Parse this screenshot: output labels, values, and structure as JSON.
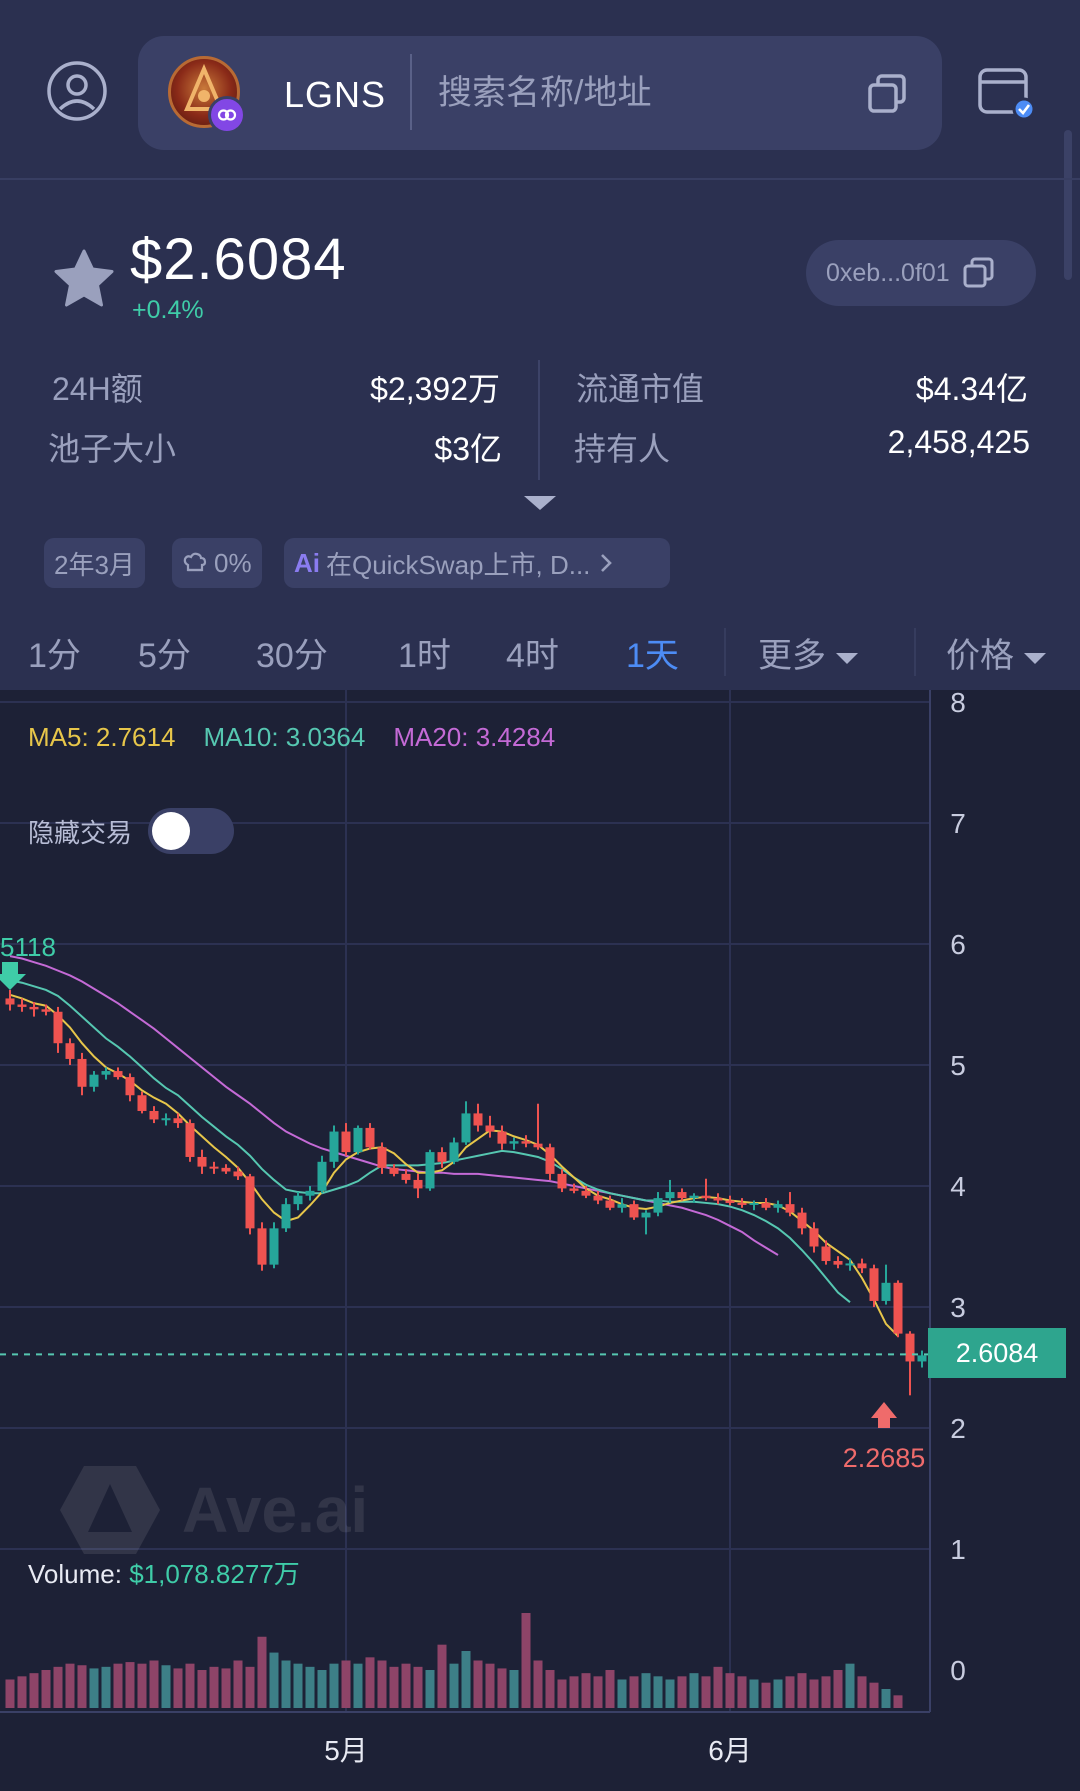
{
  "header": {
    "token_symbol": "LGNS",
    "search_placeholder": "搜索名称/地址"
  },
  "price_panel": {
    "price": "$2.6084",
    "change": "+0.4%",
    "address": "0xeb...0f01"
  },
  "stats": {
    "volume_24h_label": "24H额",
    "volume_24h_value": "$2,392万",
    "market_cap_label": "流通市值",
    "market_cap_value": "$4.34亿",
    "pool_size_label": "池子大小",
    "pool_size_value": "$3亿",
    "holders_label": "持有人",
    "holders_value": "2,458,425"
  },
  "tags": {
    "age": "2年3月",
    "tax": "0%",
    "ai_label": "Ai",
    "ai_summary": "在QuickSwap上市, D..."
  },
  "tabs": [
    {
      "label": "1分",
      "active": false
    },
    {
      "label": "5分",
      "active": false
    },
    {
      "label": "30分",
      "active": false
    },
    {
      "label": "1时",
      "active": false
    },
    {
      "label": "4时",
      "active": false
    },
    {
      "label": "1天",
      "active": true
    }
  ],
  "tab_more": "更多",
  "tab_price": "价格",
  "indicators": {
    "ma5": "MA5: 2.7614",
    "ma10": "MA10: 3.0364",
    "ma20": "MA20: 3.4284",
    "ma5_color": "#e7c64a",
    "ma10_color": "#56c7b1",
    "ma20_color": "#c46ad6"
  },
  "hide_trades_label": "隐藏交易",
  "hide_trades_on": false,
  "volume": {
    "label": "Volume:",
    "value": "$1,078.8277万"
  },
  "watermark": "Ave.ai",
  "colors": {
    "up": "#26a69a",
    "down": "#ef5350",
    "accent": "#4d8cf5",
    "positive": "#3fcca8"
  },
  "chart_data": {
    "type": "candlestick",
    "interval": "1天",
    "y_axis_ticks": [
      0,
      1,
      2,
      3,
      4,
      5,
      6,
      7,
      8
    ],
    "x_axis_ticks": [
      "5月",
      "6月"
    ],
    "x_tick_index": {
      "5月": 28,
      "6月": 60
    },
    "ylim": [
      0,
      8
    ],
    "current_price": 2.6084,
    "current_price_label": "2.6084",
    "marked_high": 5.5118,
    "marked_high_label": "5118",
    "marked_high_index": 0,
    "marked_low": 2.2685,
    "marked_low_label": "2.2685",
    "marked_low_index": 71,
    "candles": [
      {
        "o": 5.55,
        "h": 5.62,
        "l": 5.45,
        "c": 5.5
      },
      {
        "o": 5.5,
        "h": 5.55,
        "l": 5.44,
        "c": 5.48
      },
      {
        "o": 5.48,
        "h": 5.52,
        "l": 5.4,
        "c": 5.46
      },
      {
        "o": 5.46,
        "h": 5.5,
        "l": 5.41,
        "c": 5.44
      },
      {
        "o": 5.44,
        "h": 5.48,
        "l": 5.1,
        "c": 5.18
      },
      {
        "o": 5.18,
        "h": 5.22,
        "l": 5.0,
        "c": 5.05
      },
      {
        "o": 5.05,
        "h": 5.1,
        "l": 4.75,
        "c": 4.82
      },
      {
        "o": 4.82,
        "h": 4.95,
        "l": 4.78,
        "c": 4.92
      },
      {
        "o": 4.92,
        "h": 4.98,
        "l": 4.88,
        "c": 4.95
      },
      {
        "o": 4.95,
        "h": 4.98,
        "l": 4.88,
        "c": 4.9
      },
      {
        "o": 4.9,
        "h": 4.93,
        "l": 4.7,
        "c": 4.75
      },
      {
        "o": 4.75,
        "h": 4.78,
        "l": 4.6,
        "c": 4.62
      },
      {
        "o": 4.62,
        "h": 4.66,
        "l": 4.52,
        "c": 4.55
      },
      {
        "o": 4.55,
        "h": 4.6,
        "l": 4.5,
        "c": 4.56
      },
      {
        "o": 4.56,
        "h": 4.6,
        "l": 4.48,
        "c": 4.52
      },
      {
        "o": 4.52,
        "h": 4.55,
        "l": 4.2,
        "c": 4.24
      },
      {
        "o": 4.24,
        "h": 4.3,
        "l": 4.1,
        "c": 4.16
      },
      {
        "o": 4.16,
        "h": 4.2,
        "l": 4.1,
        "c": 4.15
      },
      {
        "o": 4.15,
        "h": 4.18,
        "l": 4.1,
        "c": 4.12
      },
      {
        "o": 4.12,
        "h": 4.16,
        "l": 4.05,
        "c": 4.08
      },
      {
        "o": 4.08,
        "h": 4.1,
        "l": 3.6,
        "c": 3.65
      },
      {
        "o": 3.65,
        "h": 3.7,
        "l": 3.3,
        "c": 3.35
      },
      {
        "o": 3.35,
        "h": 3.7,
        "l": 3.32,
        "c": 3.65
      },
      {
        "o": 3.65,
        "h": 3.9,
        "l": 3.62,
        "c": 3.85
      },
      {
        "o": 3.85,
        "h": 3.95,
        "l": 3.8,
        "c": 3.92
      },
      {
        "o": 3.92,
        "h": 4.0,
        "l": 3.88,
        "c": 3.96
      },
      {
        "o": 3.96,
        "h": 4.25,
        "l": 3.94,
        "c": 4.2
      },
      {
        "o": 4.2,
        "h": 4.5,
        "l": 4.15,
        "c": 4.45
      },
      {
        "o": 4.45,
        "h": 4.52,
        "l": 4.25,
        "c": 4.28
      },
      {
        "o": 4.28,
        "h": 4.5,
        "l": 4.26,
        "c": 4.48
      },
      {
        "o": 4.48,
        "h": 4.52,
        "l": 4.3,
        "c": 4.32
      },
      {
        "o": 4.32,
        "h": 4.36,
        "l": 4.1,
        "c": 4.15
      },
      {
        "o": 4.15,
        "h": 4.18,
        "l": 4.08,
        "c": 4.1
      },
      {
        "o": 4.1,
        "h": 4.14,
        "l": 4.02,
        "c": 4.05
      },
      {
        "o": 4.05,
        "h": 4.1,
        "l": 3.9,
        "c": 3.98
      },
      {
        "o": 3.98,
        "h": 4.3,
        "l": 3.96,
        "c": 4.28
      },
      {
        "o": 4.28,
        "h": 4.32,
        "l": 4.15,
        "c": 4.2
      },
      {
        "o": 4.2,
        "h": 4.4,
        "l": 4.18,
        "c": 4.36
      },
      {
        "o": 4.36,
        "h": 4.7,
        "l": 4.34,
        "c": 4.6
      },
      {
        "o": 4.6,
        "h": 4.68,
        "l": 4.45,
        "c": 4.5
      },
      {
        "o": 4.5,
        "h": 4.58,
        "l": 4.4,
        "c": 4.45
      },
      {
        "o": 4.45,
        "h": 4.5,
        "l": 4.3,
        "c": 4.35
      },
      {
        "o": 4.35,
        "h": 4.4,
        "l": 4.3,
        "c": 4.37
      },
      {
        "o": 4.37,
        "h": 4.42,
        "l": 4.32,
        "c": 4.35
      },
      {
        "o": 4.35,
        "h": 4.68,
        "l": 4.3,
        "c": 4.32
      },
      {
        "o": 4.32,
        "h": 4.35,
        "l": 4.05,
        "c": 4.1
      },
      {
        "o": 4.1,
        "h": 4.14,
        "l": 3.95,
        "c": 3.98
      },
      {
        "o": 3.98,
        "h": 4.02,
        "l": 3.94,
        "c": 3.96
      },
      {
        "o": 3.96,
        "h": 4.0,
        "l": 3.9,
        "c": 3.92
      },
      {
        "o": 3.92,
        "h": 3.96,
        "l": 3.85,
        "c": 3.88
      },
      {
        "o": 3.88,
        "h": 3.92,
        "l": 3.8,
        "c": 3.82
      },
      {
        "o": 3.82,
        "h": 3.9,
        "l": 3.78,
        "c": 3.85
      },
      {
        "o": 3.85,
        "h": 3.88,
        "l": 3.72,
        "c": 3.74
      },
      {
        "o": 3.74,
        "h": 3.8,
        "l": 3.6,
        "c": 3.78
      },
      {
        "o": 3.78,
        "h": 3.95,
        "l": 3.75,
        "c": 3.9
      },
      {
        "o": 3.9,
        "h": 4.05,
        "l": 3.86,
        "c": 3.95
      },
      {
        "o": 3.95,
        "h": 3.98,
        "l": 3.88,
        "c": 3.9
      },
      {
        "o": 3.9,
        "h": 3.94,
        "l": 3.86,
        "c": 3.92
      },
      {
        "o": 3.92,
        "h": 4.06,
        "l": 3.88,
        "c": 3.9
      },
      {
        "o": 3.9,
        "h": 3.94,
        "l": 3.85,
        "c": 3.88
      },
      {
        "o": 3.88,
        "h": 3.92,
        "l": 3.84,
        "c": 3.86
      },
      {
        "o": 3.86,
        "h": 3.9,
        "l": 3.82,
        "c": 3.85
      },
      {
        "o": 3.85,
        "h": 3.88,
        "l": 3.8,
        "c": 3.86
      },
      {
        "o": 3.86,
        "h": 3.9,
        "l": 3.8,
        "c": 3.82
      },
      {
        "o": 3.82,
        "h": 3.88,
        "l": 3.78,
        "c": 3.85
      },
      {
        "o": 3.85,
        "h": 3.95,
        "l": 3.75,
        "c": 3.78
      },
      {
        "o": 3.78,
        "h": 3.82,
        "l": 3.6,
        "c": 3.65
      },
      {
        "o": 3.65,
        "h": 3.7,
        "l": 3.45,
        "c": 3.5
      },
      {
        "o": 3.5,
        "h": 3.55,
        "l": 3.35,
        "c": 3.38
      },
      {
        "o": 3.38,
        "h": 3.42,
        "l": 3.32,
        "c": 3.35
      },
      {
        "o": 3.35,
        "h": 3.4,
        "l": 3.3,
        "c": 3.36
      },
      {
        "o": 3.36,
        "h": 3.4,
        "l": 3.28,
        "c": 3.32
      },
      {
        "o": 3.32,
        "h": 3.35,
        "l": 3.0,
        "c": 3.05
      },
      {
        "o": 3.05,
        "h": 3.35,
        "l": 3.02,
        "c": 3.2
      },
      {
        "o": 3.2,
        "h": 3.22,
        "l": 2.75,
        "c": 2.78
      },
      {
        "o": 2.78,
        "h": 2.8,
        "l": 2.27,
        "c": 2.55
      },
      {
        "o": 2.55,
        "h": 2.64,
        "l": 2.5,
        "c": 2.6
      },
      {
        "o": 2.6,
        "h": 2.62,
        "l": 2.58,
        "c": 2.61
      }
    ],
    "ma5": [
      5.58,
      5.55,
      5.51,
      5.49,
      5.41,
      5.31,
      5.18,
      5.07,
      4.98,
      4.93,
      4.87,
      4.79,
      4.73,
      4.68,
      4.6,
      4.5,
      4.41,
      4.32,
      4.24,
      4.15,
      4.03,
      3.89,
      3.78,
      3.71,
      3.74,
      3.84,
      3.95,
      4.11,
      4.22,
      4.28,
      4.31,
      4.32,
      4.27,
      4.18,
      4.11,
      4.11,
      4.13,
      4.2,
      4.32,
      4.39,
      4.46,
      4.45,
      4.41,
      4.38,
      4.34,
      4.26,
      4.16,
      4.07,
      3.98,
      3.92,
      3.89,
      3.85,
      3.82,
      3.81,
      3.83,
      3.86,
      3.88,
      3.9,
      3.91,
      3.9,
      3.88,
      3.87,
      3.86,
      3.86,
      3.84,
      3.79,
      3.71,
      3.63,
      3.53,
      3.46,
      3.39,
      3.24,
      3.06,
      2.86,
      2.76
    ],
    "ma10": [
      5.7,
      5.68,
      5.65,
      5.62,
      5.57,
      5.49,
      5.4,
      5.31,
      5.22,
      5.15,
      5.07,
      4.98,
      4.89,
      4.81,
      4.75,
      4.66,
      4.57,
      4.49,
      4.41,
      4.34,
      4.25,
      4.14,
      4.05,
      3.97,
      3.95,
      3.94,
      3.94,
      3.97,
      4.0,
      4.04,
      4.11,
      4.17,
      4.17,
      4.17,
      4.17,
      4.18,
      4.19,
      4.21,
      4.23,
      4.25,
      4.27,
      4.29,
      4.28,
      4.26,
      4.24,
      4.2,
      4.14,
      4.07,
      4.01,
      3.97,
      3.94,
      3.92,
      3.9,
      3.88,
      3.88,
      3.87,
      3.87,
      3.87,
      3.86,
      3.85,
      3.83,
      3.8,
      3.76,
      3.71,
      3.65,
      3.57,
      3.47,
      3.36,
      3.24,
      3.12,
      3.04
    ],
    "ma20": [
      5.9,
      5.88,
      5.85,
      5.82,
      5.78,
      5.74,
      5.69,
      5.63,
      5.57,
      5.51,
      5.44,
      5.37,
      5.3,
      5.22,
      5.14,
      5.06,
      4.98,
      4.9,
      4.82,
      4.75,
      4.68,
      4.6,
      4.52,
      4.45,
      4.4,
      4.35,
      4.31,
      4.28,
      4.25,
      4.22,
      4.19,
      4.16,
      4.14,
      4.13,
      4.12,
      4.11,
      4.11,
      4.1,
      4.1,
      4.1,
      4.09,
      4.08,
      4.07,
      4.06,
      4.05,
      4.04,
      4.02,
      4.0,
      3.98,
      3.96,
      3.94,
      3.92,
      3.9,
      3.88,
      3.86,
      3.84,
      3.82,
      3.79,
      3.76,
      3.72,
      3.67,
      3.62,
      3.55,
      3.49,
      3.43
    ],
    "volumes": [
      0.18,
      0.2,
      0.22,
      0.24,
      0.26,
      0.28,
      0.27,
      0.25,
      0.26,
      0.28,
      0.29,
      0.28,
      0.3,
      0.27,
      0.25,
      0.28,
      0.24,
      0.26,
      0.25,
      0.3,
      0.26,
      0.45,
      0.35,
      0.3,
      0.28,
      0.26,
      0.24,
      0.28,
      0.3,
      0.28,
      0.32,
      0.3,
      0.26,
      0.28,
      0.26,
      0.24,
      0.4,
      0.28,
      0.36,
      0.3,
      0.28,
      0.25,
      0.24,
      0.6,
      0.3,
      0.24,
      0.18,
      0.2,
      0.22,
      0.2,
      0.24,
      0.18,
      0.2,
      0.22,
      0.2,
      0.18,
      0.2,
      0.22,
      0.2,
      0.26,
      0.22,
      0.2,
      0.18,
      0.16,
      0.18,
      0.2,
      0.22,
      0.18,
      0.2,
      0.24,
      0.28,
      0.2,
      0.16,
      0.12,
      0.08
    ]
  }
}
